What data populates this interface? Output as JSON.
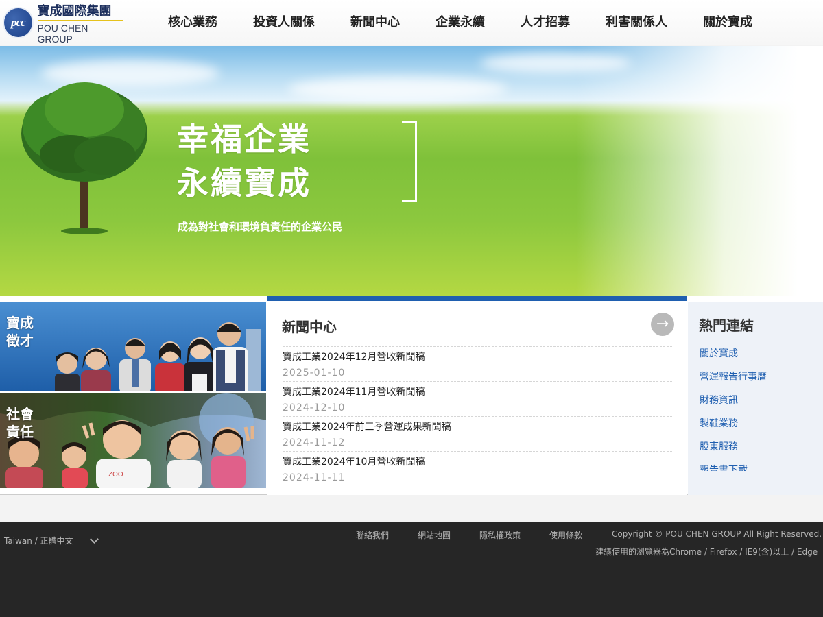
{
  "brand": {
    "name_zh": "寶成國際集團",
    "name_en": "POU CHEN GROUP",
    "mark": "pcc"
  },
  "nav": {
    "items": [
      "核心業務",
      "投資人關係",
      "新聞中心",
      "企業永續",
      "人才招募",
      "利害關係人",
      "關於寶成"
    ]
  },
  "hero": {
    "title_line1": "幸福企業",
    "title_line2": "永續寶成",
    "subtitle": "成為對社會和環境負責任的企業公民"
  },
  "promos": {
    "recruit": "寶成\n徵才",
    "recruit_l1": "寶成",
    "recruit_l2": "徵才",
    "csr_l1": "社會",
    "csr_l2": "責任"
  },
  "news": {
    "title": "新聞中心",
    "more_icon": "arrow-right-icon",
    "items": [
      {
        "headline": "寶成工業2024年12月營收新聞稿",
        "date": "2025-01-10"
      },
      {
        "headline": "寶成工業2024年11月營收新聞稿",
        "date": "2024-12-10"
      },
      {
        "headline": "寶成工業2024年前三季營運成果新聞稿",
        "date": "2024-11-12"
      },
      {
        "headline": "寶成工業2024年10月營收新聞稿",
        "date": "2024-11-11"
      }
    ]
  },
  "hot_links": {
    "title": "熱門連結",
    "items": [
      "關於寶成",
      "營運報告行事曆",
      "財務資訊",
      "製鞋業務",
      "股東服務",
      "報告書下載"
    ]
  },
  "footer": {
    "language": "Taiwan / 正體中文",
    "links": [
      "聯絡我們",
      "網站地圖",
      "隱私權政策",
      "使用條款"
    ],
    "copyright": "Copyright © POU CHEN GROUP All Right Reserved.",
    "browser_note": "建議使用的瀏覽器為Chrome / Firefox / IE9(含)以上 / Edge"
  },
  "colors": {
    "accent": "#1f5fb0",
    "footer_bg": "#262626",
    "brand_navy": "#1c2e5c",
    "brand_gold": "#e6c21c"
  }
}
